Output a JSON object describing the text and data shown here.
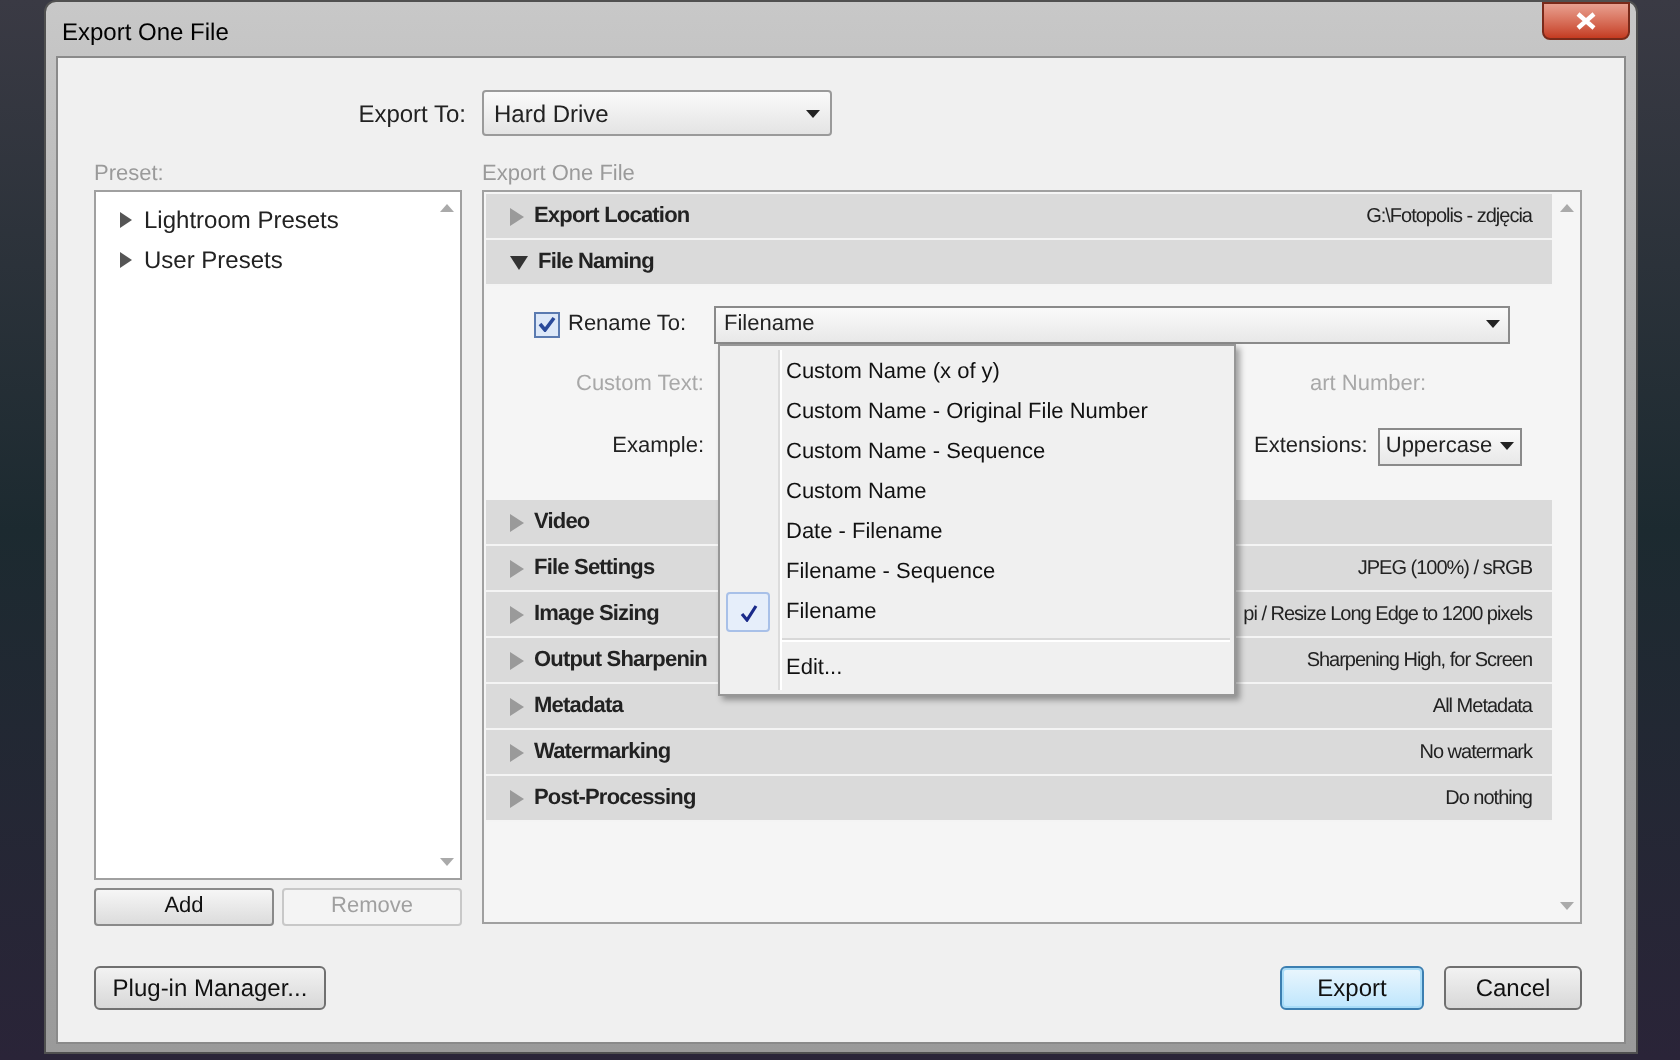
{
  "window": {
    "title": "Export One File"
  },
  "export_to": {
    "label": "Export To:",
    "value": "Hard Drive"
  },
  "preset": {
    "label": "Preset:",
    "items": [
      {
        "label": "Lightroom Presets"
      },
      {
        "label": "User Presets"
      }
    ],
    "buttons": [
      {
        "label": "Add",
        "disabled": false
      },
      {
        "label": "Remove",
        "disabled": true
      }
    ]
  },
  "panel": {
    "title": "Export One File",
    "sections": [
      {
        "title": "Export Location",
        "expanded": false,
        "summary": "G:\\Fotopolis - zdjęcia"
      },
      {
        "title": "File Naming",
        "expanded": true
      },
      {
        "title": "Video",
        "expanded": false
      },
      {
        "title": "File Settings",
        "expanded": false,
        "summary": "JPEG (100%) / sRGB"
      },
      {
        "title": "Image Sizing",
        "expanded": false,
        "summary": "pi / Resize Long Edge to 1200 pixels"
      },
      {
        "title": "Output Sharpenin",
        "expanded": false,
        "summary": "Sharpening High, for Screen"
      },
      {
        "title": "Metadata",
        "expanded": false,
        "summary": "All Metadata"
      },
      {
        "title": "Watermarking",
        "expanded": false,
        "summary": "No watermark"
      },
      {
        "title": "Post-Processing",
        "expanded": false,
        "summary": "Do nothing"
      }
    ]
  },
  "file_naming": {
    "rename": {
      "label": "Rename To:",
      "checked": true,
      "value": "Filename"
    },
    "custom_text": {
      "label": "Custom Text:",
      "disabled": true
    },
    "start_number": {
      "label": "art Number:",
      "disabled": true
    },
    "example": {
      "label": "Example:"
    },
    "extensions": {
      "label": "Extensions:",
      "value": "Uppercase"
    }
  },
  "menu": {
    "items": [
      {
        "label": "Custom Name (x of y)",
        "kind": "option",
        "selected": false
      },
      {
        "label": "Custom Name - Original File Number",
        "kind": "option",
        "selected": false
      },
      {
        "label": "Custom Name - Sequence",
        "kind": "option",
        "selected": false
      },
      {
        "label": "Custom Name",
        "kind": "option",
        "selected": false
      },
      {
        "label": "Date - Filename",
        "kind": "option",
        "selected": false
      },
      {
        "label": "Filename - Sequence",
        "kind": "option",
        "selected": false
      },
      {
        "label": "Filename",
        "kind": "option",
        "selected": true
      },
      {
        "label": "Edit...",
        "kind": "command",
        "selected": false
      }
    ]
  },
  "footer": {
    "buttons": [
      {
        "label": "Plug-in Manager...",
        "kind": "default"
      },
      {
        "label": "Export",
        "kind": "primary"
      },
      {
        "label": "Cancel",
        "kind": "default"
      }
    ]
  }
}
